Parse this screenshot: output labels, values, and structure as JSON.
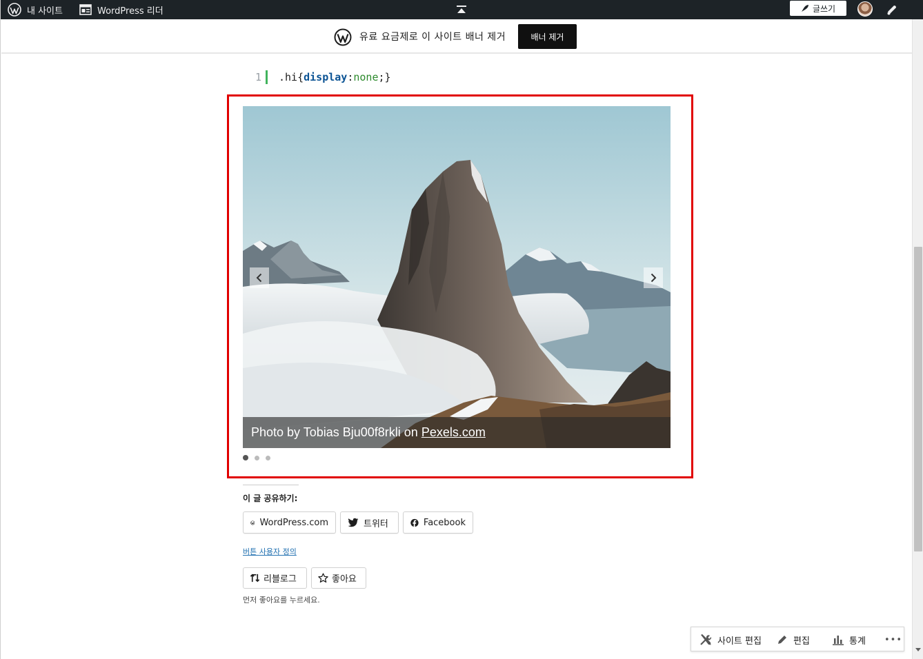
{
  "admin_bar": {
    "my_site": "내 사이트",
    "reader": "WordPress 리더",
    "write": "글쓰기"
  },
  "banner": {
    "text": "유료 요금제로 이 사이트 배너 제거",
    "button": "배너 제거"
  },
  "code": {
    "line_number": "1",
    "selector": ".hi",
    "open_brace": "{",
    "property": "display",
    "colon": ":",
    "value": "none",
    "close": ";}"
  },
  "slideshow": {
    "caption_prefix": "Photo by Tobias Bju00f8rkli on",
    "caption_link": "Pexels.com",
    "slide_count": 3,
    "active_slide": 1,
    "prev_icon": "chevron-left-icon",
    "next_icon": "chevron-right-icon"
  },
  "sharing": {
    "title": "이 글 공유하기:",
    "buttons": [
      {
        "label": "WordPress.com",
        "icon": "wordpress-icon"
      },
      {
        "label": "트위터",
        "icon": "twitter-icon"
      },
      {
        "label": "Facebook",
        "icon": "facebook-icon"
      }
    ],
    "customize": "버튼 사용자 정의"
  },
  "likes": {
    "reblog": "리블로그",
    "like": "좋아요",
    "note": "먼저 좋아요를 누르세요."
  },
  "action_bar": {
    "site_edit": "사이트 편집",
    "edit": "편집",
    "stats": "통계",
    "more": "•••"
  },
  "colors": {
    "admin_bar_bg": "#1d2327",
    "highlight_border": "#e10000",
    "link": "#2271b1",
    "code_property": "#0b5394",
    "code_value": "#2c8a2c",
    "code_gutter_bar": "#41b35d"
  }
}
